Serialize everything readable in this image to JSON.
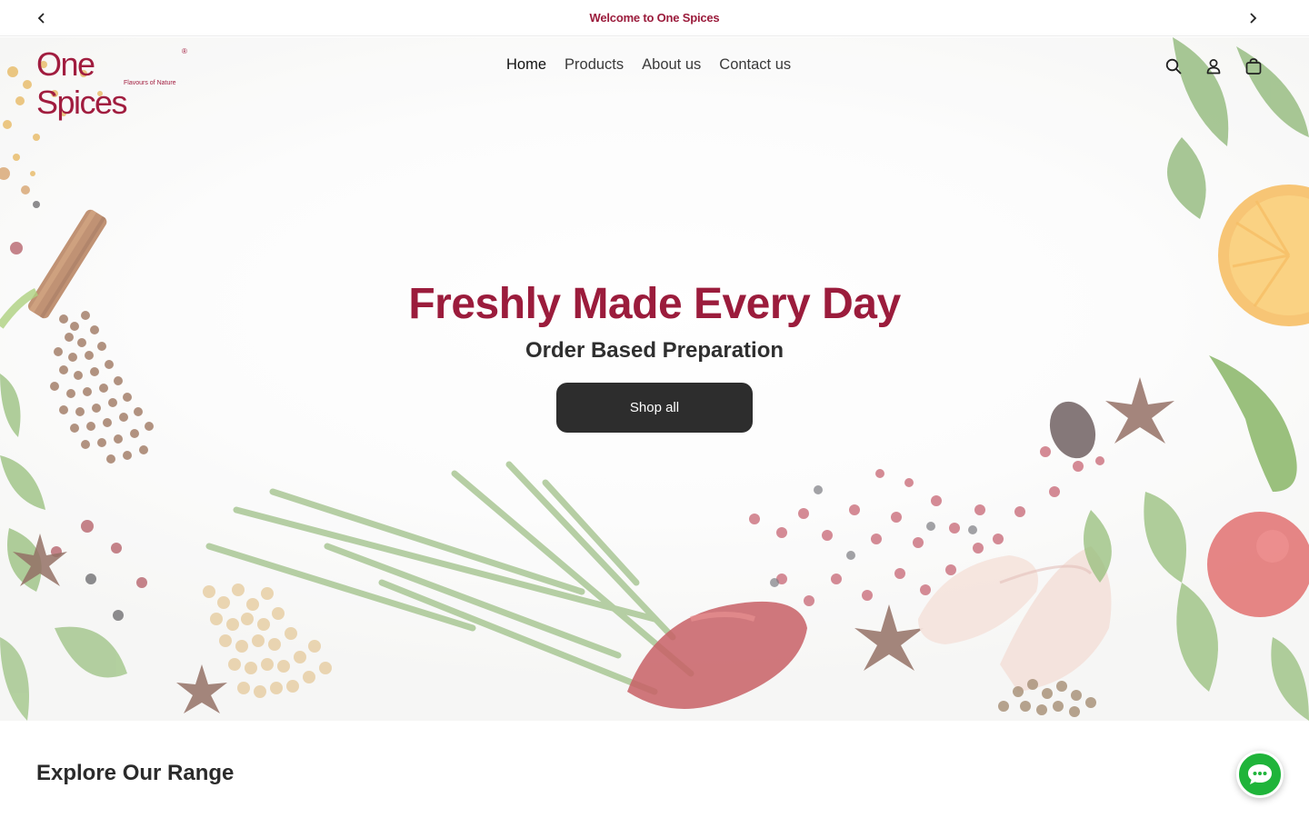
{
  "announcement": {
    "text": "Welcome to One Spices",
    "prev_icon": "chevron-left-icon",
    "next_icon": "chevron-right-icon"
  },
  "brand": {
    "name": "One Spices",
    "tagline": "Flavours of Nature",
    "registered": "®",
    "color": "#9b1c3c"
  },
  "nav": {
    "items": [
      {
        "label": "Home",
        "active": true
      },
      {
        "label": "Products",
        "active": false
      },
      {
        "label": "About us",
        "active": false
      },
      {
        "label": "Contact us",
        "active": false
      }
    ]
  },
  "header_icons": [
    "search-icon",
    "account-icon",
    "cart-icon"
  ],
  "hero": {
    "title": "Freshly Made Every Day",
    "subtitle": "Order Based Preparation",
    "cta_label": "Shop all",
    "title_color": "#9b1c3c",
    "cta_color": "#2d2d2d"
  },
  "section": {
    "title": "Explore Our Range"
  },
  "chat": {
    "icon": "chat-bubble-icon",
    "color": "#1fb43a"
  }
}
